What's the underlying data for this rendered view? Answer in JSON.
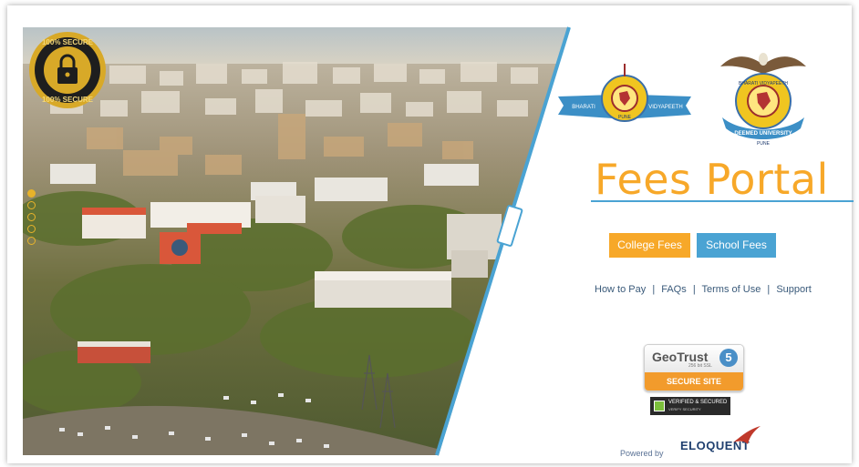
{
  "seal": {
    "text_top": "100% SECURE",
    "text_bottom": "100% SECURE"
  },
  "slider": {
    "dots": [
      "slide-1",
      "slide-2",
      "slide-3",
      "slide-4",
      "slide-5"
    ],
    "active_index": 0
  },
  "logos": {
    "logo1": {
      "left_text": "BHARATI",
      "right_text": "VIDYAPEETH",
      "bottom_text": "PUNE"
    },
    "logo2": {
      "top_text": "BHARATI VIDYAPEETH",
      "ribbon_text": "DEEMED UNIVERSITY",
      "bottom_text": "PUNE"
    }
  },
  "portal": {
    "title": "Fees Portal",
    "college_button": "College Fees",
    "school_button": "School Fees"
  },
  "links": {
    "how_to_pay": "How to Pay",
    "faqs": "FAQs",
    "terms": "Terms of Use",
    "support": "Support",
    "separator": "|"
  },
  "geotrust": {
    "name": "GeoTrust",
    "sub": "256 bit SSL",
    "badge": "5",
    "bottom": "SECURE SITE"
  },
  "verified": {
    "line1": "VERIFIED & SECURED",
    "line2": "VERIFY SECURITY"
  },
  "footer": {
    "powered": "Powered by",
    "brand": "ELOQUENT"
  },
  "colors": {
    "accent_orange": "#f7a829",
    "accent_blue": "#4aa3d3",
    "link_text": "#3a5a7a"
  }
}
